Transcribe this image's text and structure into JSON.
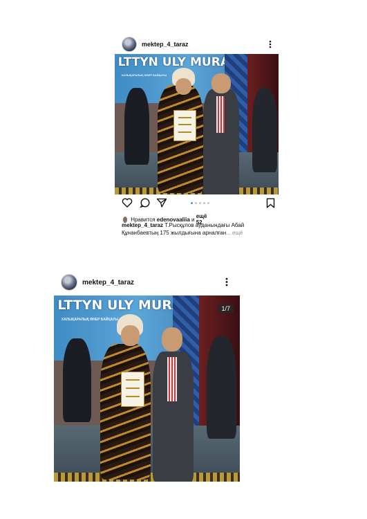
{
  "post1": {
    "username": "mektep_4_taraz",
    "banner_title": "LTTYN ULY MURASY",
    "banner_subtitle": "ХАЛЫҚАРАЛЫҚ ӨНЕР БАЙҚАУЫ",
    "likes_prefix": "Нравится",
    "likes_user": "edenovaaliia",
    "likes_mid": "и",
    "likes_rest": "ещё 52",
    "caption_text": "Т.Рысқұлов ауданындағы Абай Құнанбаевтың 175 жылдығына арналған",
    "caption_more": "... ещё",
    "carousel_dots": 5,
    "active_dot": 0
  },
  "post2": {
    "username": "mektep_4_taraz",
    "banner_title": "LTTYN ULY MURASY",
    "banner_subtitle": "ХАЛЫҚАРАЛЫҚ ӨНЕР БАЙҚАУЫ",
    "counter": "1/7"
  },
  "icons": {
    "like": "heart-icon",
    "comment": "comment-icon",
    "share": "send-icon",
    "save": "bookmark-icon",
    "more": "more-vertical-icon"
  },
  "colors": {
    "accent_blue": "#3897f0",
    "text": "#111111",
    "muted": "#8e8e8e"
  }
}
